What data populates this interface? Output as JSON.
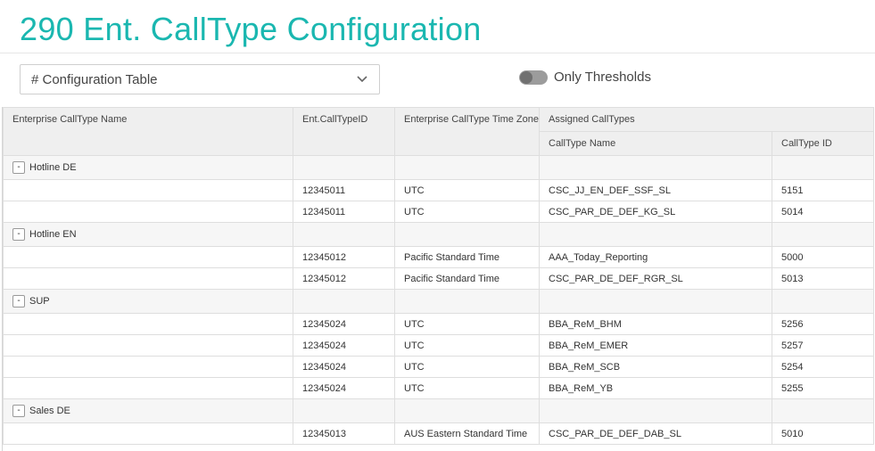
{
  "title": "290 Ent. CallType Configuration",
  "view_select": {
    "value": "# Configuration Table",
    "icon": "chevron-down-icon"
  },
  "toggle": {
    "label": "Only Thresholds",
    "on": false
  },
  "columns": {
    "name": "Enterprise CallType Name",
    "id": "Ent.CallTypeID",
    "timezone": "Enterprise CallType Time Zone",
    "assigned": "Assigned CallTypes",
    "calltype_name": "CallType Name",
    "calltype_id": "CallType ID"
  },
  "groups": [
    {
      "name": "Hotline DE",
      "collapse_label": "-",
      "rows": [
        {
          "id": "12345011",
          "timezone": "UTC",
          "calltype_name": "CSC_JJ_EN_DEF_SSF_SL",
          "calltype_id": "5151"
        },
        {
          "id": "12345011",
          "timezone": "UTC",
          "calltype_name": "CSC_PAR_DE_DEF_KG_SL",
          "calltype_id": "5014"
        }
      ]
    },
    {
      "name": "Hotline EN",
      "collapse_label": "-",
      "rows": [
        {
          "id": "12345012",
          "timezone": "Pacific Standard Time",
          "calltype_name": "AAA_Today_Reporting",
          "calltype_id": "5000"
        },
        {
          "id": "12345012",
          "timezone": "Pacific Standard Time",
          "calltype_name": "CSC_PAR_DE_DEF_RGR_SL",
          "calltype_id": "5013"
        }
      ]
    },
    {
      "name": "SUP",
      "collapse_label": "-",
      "rows": [
        {
          "id": "12345024",
          "timezone": "UTC",
          "calltype_name": "BBA_ReM_BHM",
          "calltype_id": "5256"
        },
        {
          "id": "12345024",
          "timezone": "UTC",
          "calltype_name": "BBA_ReM_EMER",
          "calltype_id": "5257"
        },
        {
          "id": "12345024",
          "timezone": "UTC",
          "calltype_name": "BBA_ReM_SCB",
          "calltype_id": "5254"
        },
        {
          "id": "12345024",
          "timezone": "UTC",
          "calltype_name": "BBA_ReM_YB",
          "calltype_id": "5255"
        }
      ]
    },
    {
      "name": "Sales DE",
      "collapse_label": "-",
      "rows": [
        {
          "id": "12345013",
          "timezone": "AUS Eastern Standard Time",
          "calltype_name": "CSC_PAR_DE_DEF_DAB_SL",
          "calltype_id": "5010"
        }
      ]
    }
  ]
}
